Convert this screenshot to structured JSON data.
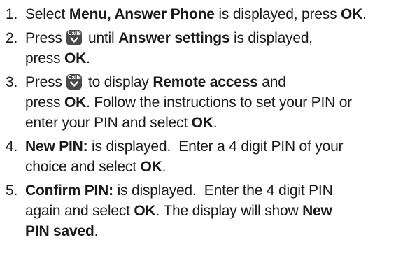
{
  "steps": [
    {
      "number": "1.",
      "lines": [
        [
          {
            "t": "Select ",
            "b": false
          },
          {
            "t": "Menu, Answer Phone",
            "b": true
          },
          {
            "t": " is displayed, press ",
            "b": false
          },
          {
            "t": "OK",
            "b": true
          },
          {
            "t": ".",
            "b": false
          }
        ]
      ]
    },
    {
      "number": "2.",
      "lines": [
        [
          {
            "t": "Press ",
            "b": false
          },
          {
            "icon": "calls-down-key"
          },
          {
            "t": " until ",
            "b": false
          },
          {
            "t": "Answer settings",
            "b": true
          },
          {
            "t": " is displayed,",
            "b": false
          }
        ],
        [
          {
            "t": "press ",
            "b": false
          },
          {
            "t": "OK",
            "b": true
          },
          {
            "t": ".",
            "b": false
          }
        ]
      ]
    },
    {
      "number": "3.",
      "lines": [
        [
          {
            "t": "Press ",
            "b": false
          },
          {
            "icon": "calls-down-key"
          },
          {
            "t": " to display ",
            "b": false
          },
          {
            "t": "Remote access",
            "b": true
          },
          {
            "t": " and",
            "b": false
          }
        ],
        [
          {
            "t": "press ",
            "b": false
          },
          {
            "t": "OK",
            "b": true
          },
          {
            "t": ". Follow the instructions to set your PIN or",
            "b": false
          }
        ],
        [
          {
            "t": "enter your PIN and select ",
            "b": false
          },
          {
            "t": "OK",
            "b": true
          },
          {
            "t": ".",
            "b": false
          }
        ]
      ]
    },
    {
      "number": "4.",
      "lines": [
        [
          {
            "t": "New PIN:",
            "b": true
          },
          {
            "t": " is displayed.  Enter a 4 digit PIN of your",
            "b": false
          }
        ],
        [
          {
            "t": "choice and select ",
            "b": false
          },
          {
            "t": "OK",
            "b": true
          },
          {
            "t": ".",
            "b": false
          }
        ]
      ]
    },
    {
      "number": "5.",
      "lines": [
        [
          {
            "t": "Confirm PIN:",
            "b": true
          },
          {
            "t": " is displayed.  Enter the 4 digit PIN",
            "b": false
          }
        ],
        [
          {
            "t": "again and select ",
            "b": false
          },
          {
            "t": "OK",
            "b": true
          },
          {
            "t": ". The display will show ",
            "b": false
          },
          {
            "t": "New",
            "b": true
          }
        ],
        [
          {
            "t": "PIN saved",
            "b": true
          },
          {
            "t": ".",
            "b": false
          }
        ]
      ]
    }
  ],
  "key_icon": {
    "label": "Calls",
    "color": "#4a4a4a",
    "glyph_color": "#ffffff"
  },
  "text_color": "#1a1a1a"
}
